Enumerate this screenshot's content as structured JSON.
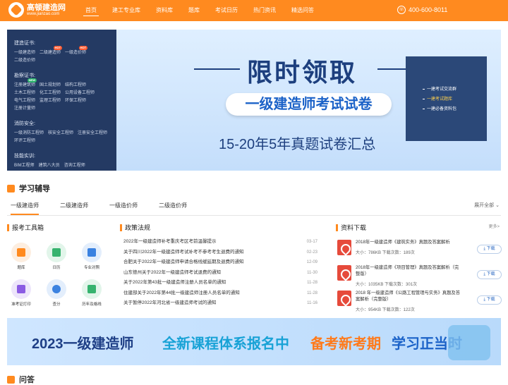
{
  "brand": {
    "name": "高顿建造网",
    "domain": "www.jianzao.com"
  },
  "nav": [
    "首页",
    "建工专业库",
    "资料库",
    "题库",
    "考试日历",
    "热门资讯",
    "精选问答"
  ],
  "phone": "400-600-8011",
  "sidebar": {
    "groups": [
      {
        "title": "建造证书:",
        "links": [
          "一级建造师",
          "二级建造师",
          "一级造价师",
          "二级造价师"
        ],
        "badges": [
          "",
          "HOT",
          "HOT",
          ""
        ]
      },
      {
        "title": "勘察证书:",
        "links": [
          "注册建筑师",
          "国土规划师",
          "结构工程师",
          "土木工程师",
          "化工工程师",
          "公用设备工程师",
          "电气工程师",
          "监理工程师",
          "环保工程师",
          "注册计量师"
        ],
        "badges": [
          "",
          "NEW",
          "",
          "",
          "",
          "",
          "",
          "",
          "",
          ""
        ]
      },
      {
        "title": "消防安全:",
        "links": [
          "一级消防工程师",
          "核安全工程师",
          "注册安全工程师",
          "环评工程师"
        ],
        "badges": [
          "",
          "",
          "",
          ""
        ]
      },
      {
        "title": "技能实训:",
        "links": [
          "BIM工程师",
          "建筑八大员",
          "咨询工程师"
        ],
        "badges": [
          "",
          "",
          ""
        ]
      }
    ]
  },
  "banner": {
    "headline": "限时领取",
    "pill": "一级建造师考试试卷",
    "sub": "15-20年5年真题试卷汇总",
    "panel": [
      "一建考试交流群",
      "一建考试题库",
      "一建必备资料包"
    ]
  },
  "study": {
    "title": "学习辅导",
    "tabs": [
      "一级建造师",
      "二级建造师",
      "一级造价师",
      "二级造价师"
    ],
    "expand": "展开全部"
  },
  "tools": {
    "title": "报考工具箱",
    "items": [
      "题库",
      "日历",
      "专业对照",
      "准考证打印",
      "查分",
      "历年及格线"
    ]
  },
  "policy": {
    "title": "政策法规",
    "rows": [
      {
        "text": "2022年一级建造师补考重庆考区考前温馨提示",
        "date": "03-17"
      },
      {
        "text": "关于四川2022年一级建造师考试补考不参考考生退费的通知",
        "date": "02-23"
      },
      {
        "text": "合肥关于2022年一级建造师申请合格线缓延期及退费的通知",
        "date": "12-09"
      },
      {
        "text": "山东德州关于2022年一级建造师考试退费的通知",
        "date": "11-30"
      },
      {
        "text": "关于2022年第43批一级建造师注册人员名单的通知",
        "date": "11-28"
      },
      {
        "text": "住建部关于2022年第44批一级建造师注册人员名单的通知",
        "date": "11-28"
      },
      {
        "text": "关于暂停2022年河北省一级建造师考试的通知",
        "date": "11-16"
      }
    ]
  },
  "downloads": {
    "title": "资料下载",
    "more": "更多>",
    "items": [
      {
        "name": "2018年一级建造师《建筑实务》真题及答案解析",
        "meta": "大小：786KB  下载次数：189次",
        "btn": "下载"
      },
      {
        "name": "2018年一级建造师《项目管理》真题及答案解析（完整版）",
        "meta": "大小：1035KB  下载次数：301次",
        "btn": "下载"
      },
      {
        "name": "2018 年一级建造师《公路工程管理与实务》真题及答案解析（完整版）",
        "meta": "大小：954KB  下载次数：122次",
        "btn": "下载"
      }
    ]
  },
  "ad": [
    "2023一级建造师",
    "全新课程体系报名中",
    "备考新考期",
    "学习正当时"
  ],
  "qa": {
    "title": "问答"
  },
  "colors": {
    "accent": "#ff8a1f",
    "navy": "#243a63",
    "link": "#2e6bc4"
  }
}
